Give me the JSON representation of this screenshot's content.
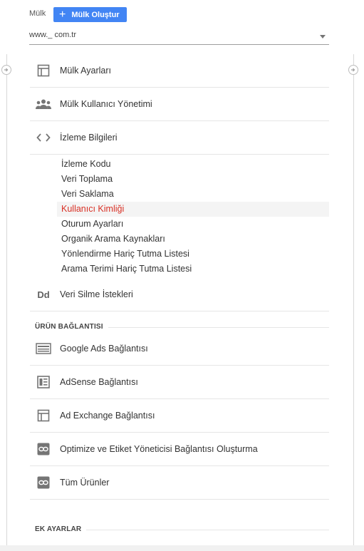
{
  "header": {
    "property_label": "Mülk",
    "create_button_label": "Mülk Oluştur",
    "create_button_icon": "plus-icon",
    "selected_property": "www._                  com.tr"
  },
  "nav": {
    "property_settings": "Mülk Ayarları",
    "user_management": "Mülk Kullanıcı Yönetimi",
    "tracking_info": "İzleme Bilgileri",
    "tracking_sub": [
      "İzleme Kodu",
      "Veri Toplama",
      "Veri Saklama",
      "Kullanıcı Kimliği",
      "Oturum Ayarları",
      "Organik Arama Kaynakları",
      "Yönlendirme Hariç Tutma Listesi",
      "Arama Terimi Hariç Tutma Listesi"
    ],
    "active_sub_index": 3,
    "data_deletion": "Veri Silme İstekleri",
    "data_deletion_icon_text": "Dd"
  },
  "product_linking": {
    "title": "ÜRÜN BAĞLANTISI",
    "google_ads": "Google Ads Bağlantısı",
    "adsense": "AdSense Bağlantısı",
    "ad_exchange": "Ad Exchange Bağlantısı",
    "optimize": "Optimize ve Etiket Yöneticisi Bağlantısı Oluşturma",
    "all_products": "Tüm Ürünler"
  },
  "extra": {
    "title": "EK AYARLAR"
  },
  "colors": {
    "accent": "#4285f4",
    "active": "#d93025",
    "icon": "#757575"
  }
}
